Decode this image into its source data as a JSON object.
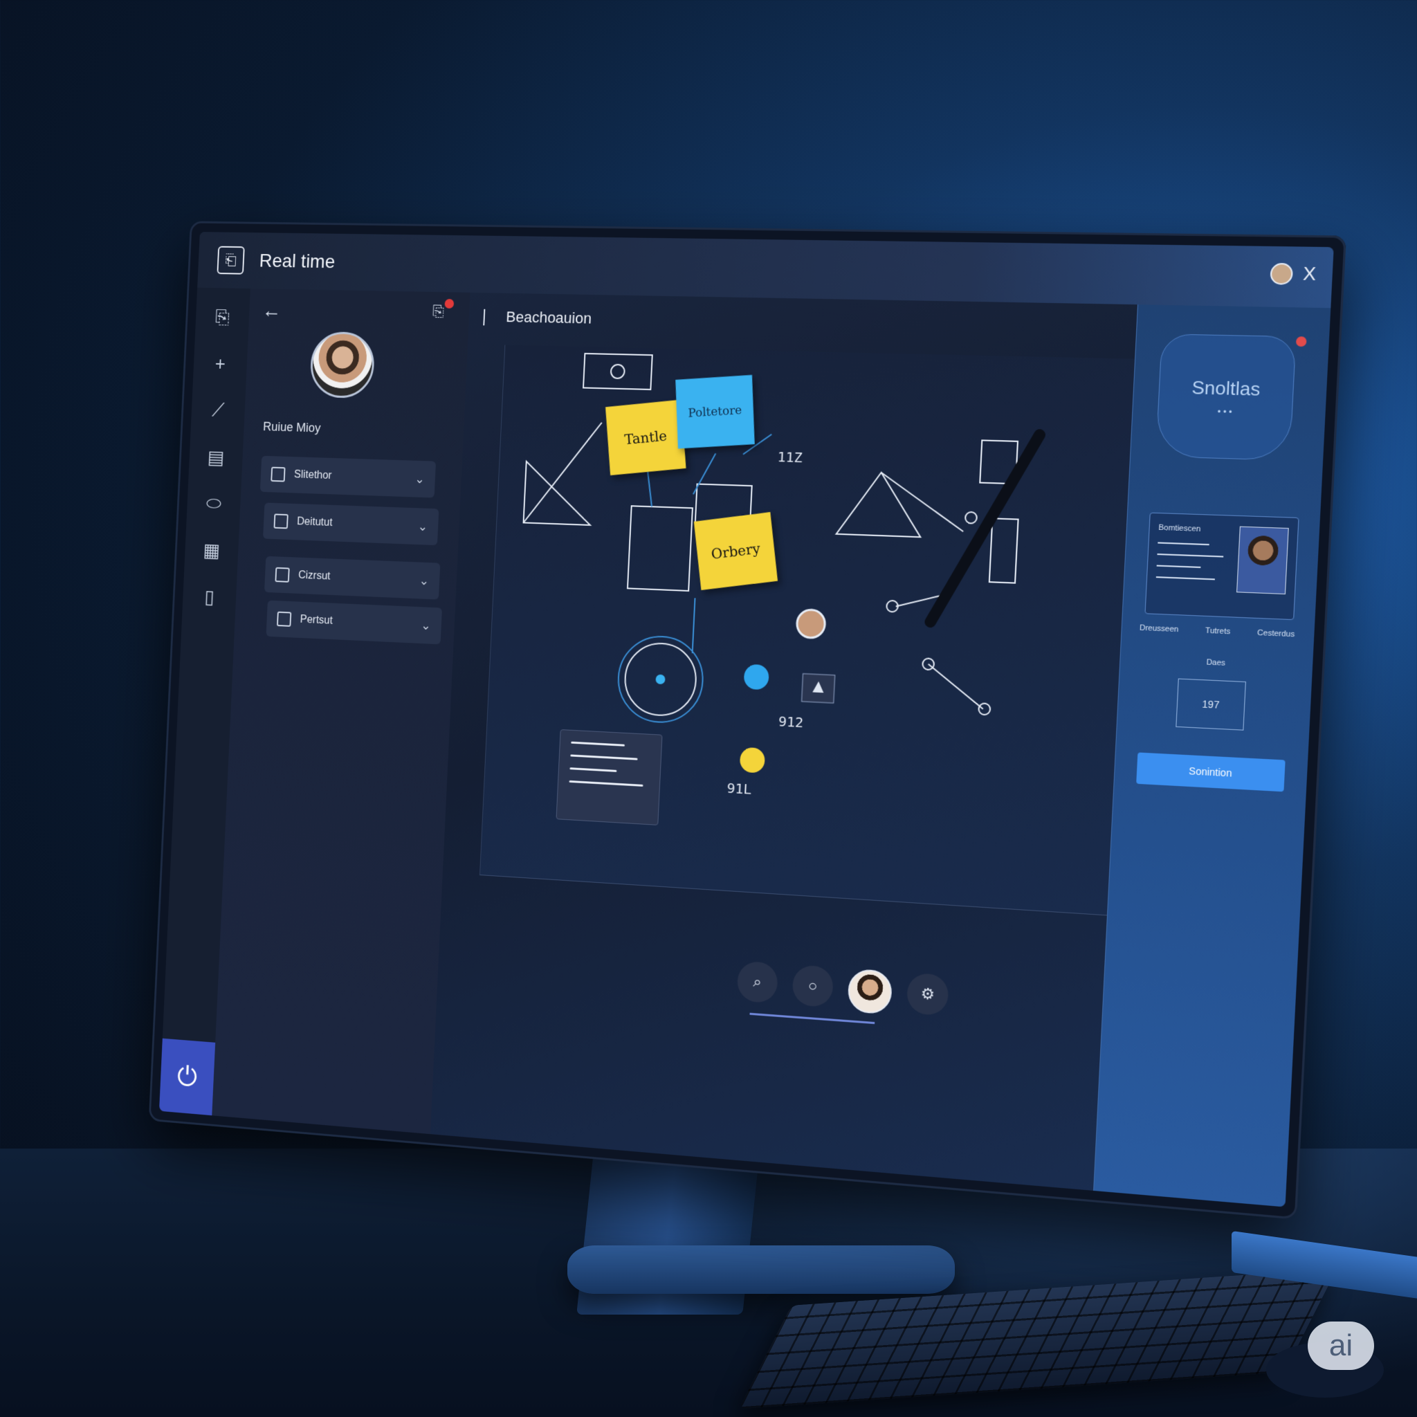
{
  "window": {
    "title": "Real time",
    "close_label": "X"
  },
  "toolrail": {
    "items": [
      {
        "name": "document",
        "icon": "document-icon",
        "glyph": "⎘"
      },
      {
        "name": "add",
        "icon": "plus-icon",
        "glyph": "+"
      },
      {
        "name": "connector",
        "icon": "connector-icon",
        "glyph": "⟋"
      },
      {
        "name": "frame",
        "icon": "frame-icon",
        "glyph": "▤"
      },
      {
        "name": "eraser",
        "icon": "eraser-icon",
        "glyph": "⬭"
      },
      {
        "name": "layout",
        "icon": "layout-icon",
        "glyph": "▦"
      },
      {
        "name": "panel",
        "icon": "panel-icon",
        "glyph": "▯"
      }
    ],
    "bottom_glyph": "⏻"
  },
  "leftpanel": {
    "profile_name": "Ruiue Mioy",
    "dropdowns": [
      {
        "label": "Slitethor"
      },
      {
        "label": "Deitutut"
      },
      {
        "label": "Cizrsut"
      },
      {
        "label": "Pertsut"
      }
    ]
  },
  "canvas": {
    "title": "Beachoauion",
    "stickies": [
      {
        "text": "Tantle",
        "color": "#f4d43a"
      },
      {
        "text": "Poltetore",
        "color": "#3ab2f0"
      },
      {
        "text": "Orbery",
        "color": "#f4d43a"
      }
    ],
    "labels": [
      "11Z",
      "912",
      "91L"
    ]
  },
  "rightpanel": {
    "card_title": "Snoltlas",
    "card_subtitle": "• • •",
    "profile_card_title": "Bomtiescen",
    "row_left": "Dreusseen",
    "row_mid": "Tutrets",
    "row_right": "Cesterdus",
    "small_label": "Daes",
    "box_value": "197",
    "button_label": "Sonintion"
  },
  "dock": {
    "buttons": [
      {
        "name": "search",
        "glyph": "⌕"
      },
      {
        "name": "chat",
        "glyph": "○"
      },
      {
        "name": "avatar",
        "glyph": ""
      },
      {
        "name": "settings",
        "glyph": "⚙"
      }
    ]
  },
  "badge": {
    "text": "ai"
  },
  "colors": {
    "accent": "#3b8ff0",
    "sticky_yellow": "#f4d43a",
    "sticky_blue": "#3ab2f0",
    "rail_bottom": "#3a4fbf",
    "alert": "#e23a3a"
  }
}
